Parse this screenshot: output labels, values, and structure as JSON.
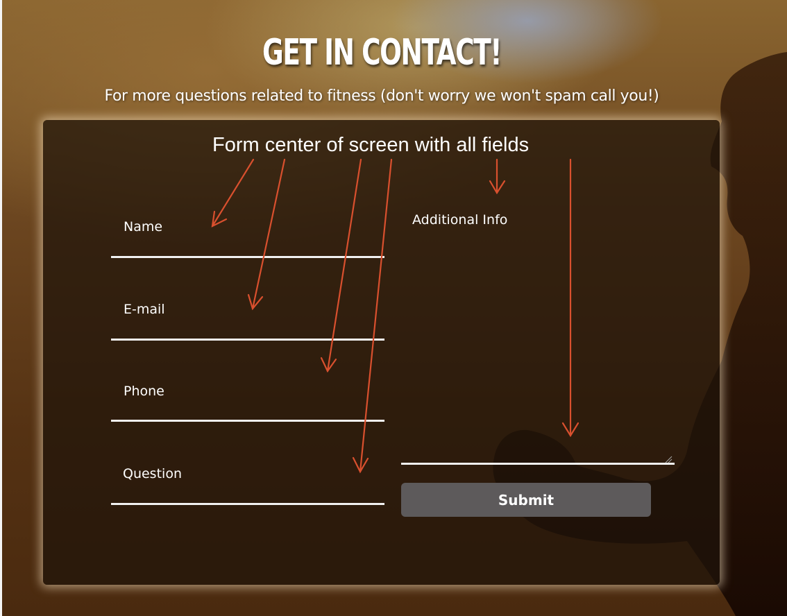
{
  "page": {
    "title": "GET IN CONTACT!",
    "subtitle": "For more questions related to fitness (don't worry we won't spam call you!)"
  },
  "annotation": {
    "text": "Form center of screen with all fields",
    "arrow_color": "#d9502e"
  },
  "form": {
    "fields": {
      "name": {
        "label": "Name",
        "value": ""
      },
      "email": {
        "label": "E-mail",
        "value": ""
      },
      "phone": {
        "label": "Phone",
        "value": ""
      },
      "question": {
        "label": "Question",
        "value": ""
      }
    },
    "additional_info": {
      "label": "Additional Info",
      "value": ""
    },
    "submit_label": "Submit"
  },
  "colors": {
    "button_background": "#5d5a5b",
    "card_background": "rgba(30,20,10,0.72)",
    "text": "#ffffff"
  }
}
